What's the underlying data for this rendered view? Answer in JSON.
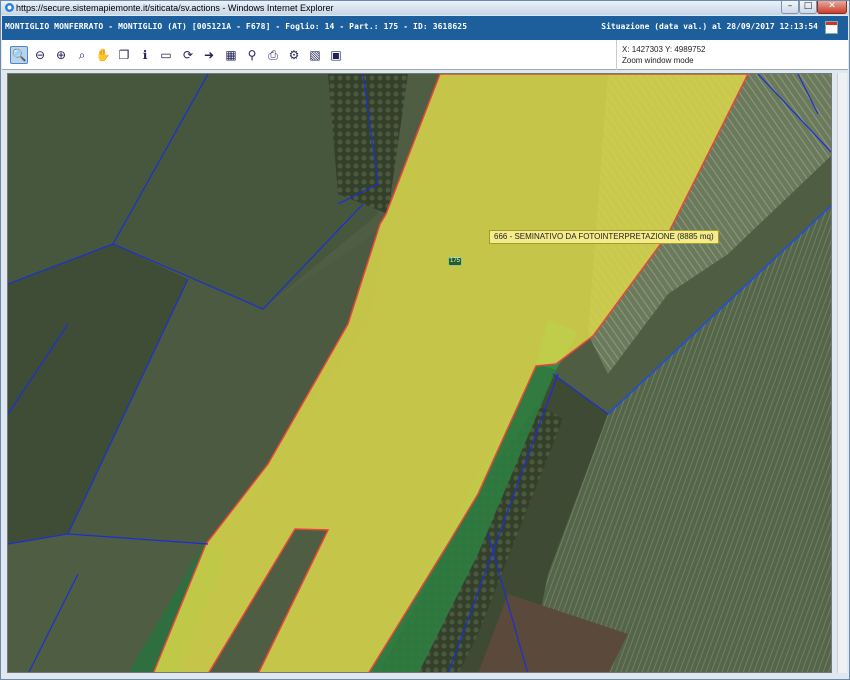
{
  "window": {
    "title": "https://secure.sistemapiemonte.it/siticata/sv.actions - Windows Internet Explorer",
    "min_label": "–",
    "max_label": "□",
    "close_label": "✕"
  },
  "infobar": {
    "left": "MONTIGLIO MONFERRATO - MONTIGLIO (AT) [005121A - F678] - Foglio: 14 - Part.: 175 - ID: 3618625",
    "right": "Situazione (data val.) al 28/09/2017 12:13:54"
  },
  "toolbar": {
    "tools": [
      {
        "name": "zoom-window-icon",
        "glyph": "🔍"
      },
      {
        "name": "zoom-out-icon",
        "glyph": "⊖"
      },
      {
        "name": "zoom-in-icon",
        "glyph": "⊕"
      },
      {
        "name": "zoom-extent-icon",
        "glyph": "⌕"
      },
      {
        "name": "pan-hand-icon",
        "glyph": "✋"
      },
      {
        "name": "copy-icon",
        "glyph": "❐"
      },
      {
        "name": "info-icon",
        "glyph": "ℹ"
      },
      {
        "name": "measure-ruler-icon",
        "glyph": "▭"
      },
      {
        "name": "refresh-icon",
        "glyph": "⟳"
      },
      {
        "name": "arrow-right-icon",
        "glyph": "➜"
      },
      {
        "name": "layers-icon",
        "glyph": "▦"
      },
      {
        "name": "search-icon",
        "glyph": "⚲"
      },
      {
        "name": "print-icon",
        "glyph": "⎙"
      },
      {
        "name": "settings-icon",
        "glyph": "⚙"
      },
      {
        "name": "chart-icon",
        "glyph": "▧"
      },
      {
        "name": "map-export-icon",
        "glyph": "▣"
      }
    ],
    "coords": "X: 1427303 Y: 4989752",
    "mode": "Zoom window mode"
  },
  "map": {
    "tooltip": "666 - SEMINATIVO DA FOTOINTERPRETAZIONE (8885 mq)",
    "parcel_label": "175",
    "colors": {
      "selected_parcel_fill": "#d9d84a",
      "selected_parcel_border": "#e8453c",
      "parcel_lines": "#1a2fd6",
      "green_strip": "#2f8f4a",
      "field_dark": "#4d5c3f"
    }
  }
}
